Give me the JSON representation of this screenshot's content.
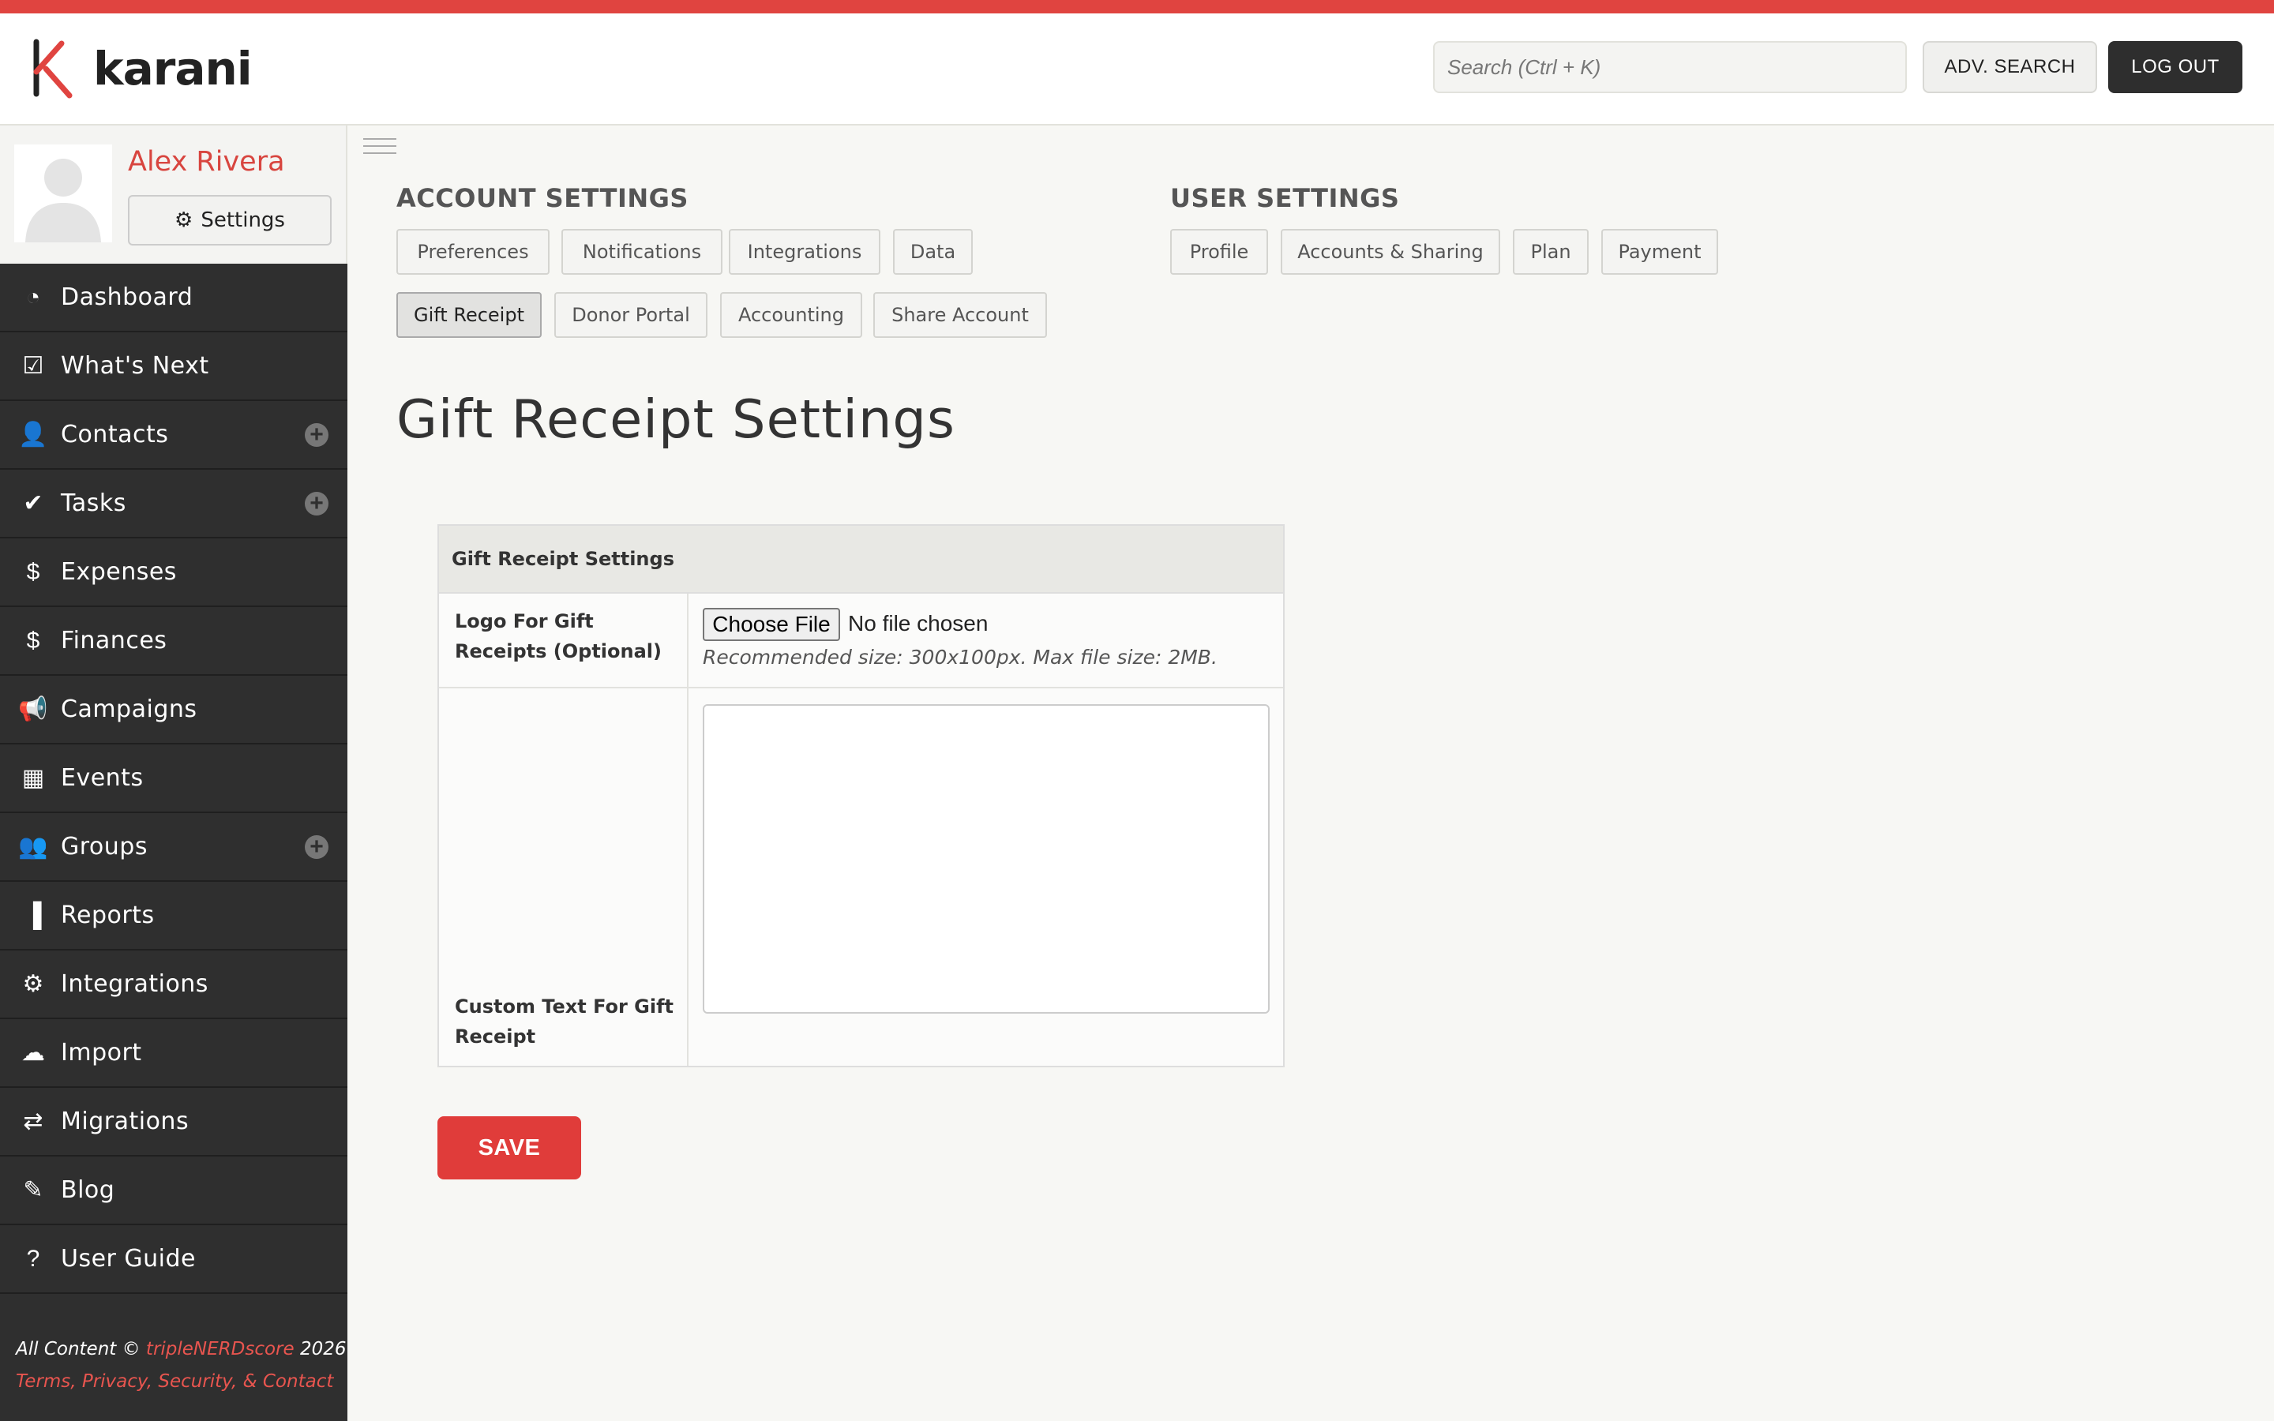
{
  "brand": {
    "name": "karani",
    "accent_color": "#e04440"
  },
  "header": {
    "search_placeholder": "Search (Ctrl + K)",
    "adv_search_label": "ADV. SEARCH",
    "logout_label": "LOG OUT"
  },
  "profile": {
    "name": "Alex Rivera",
    "settings_label": "Settings"
  },
  "sidebar": {
    "items": [
      {
        "label": "Dashboard",
        "icon": "dashboard-icon",
        "has_add": false
      },
      {
        "label": "What's Next",
        "icon": "check-square-icon",
        "has_add": false
      },
      {
        "label": "Contacts",
        "icon": "user-icon",
        "has_add": true
      },
      {
        "label": "Tasks",
        "icon": "check-icon",
        "has_add": true
      },
      {
        "label": "Expenses",
        "icon": "dollar-icon",
        "has_add": false
      },
      {
        "label": "Finances",
        "icon": "dollar-icon",
        "has_add": false
      },
      {
        "label": "Campaigns",
        "icon": "megaphone-icon",
        "has_add": false
      },
      {
        "label": "Events",
        "icon": "calendar-icon",
        "has_add": false
      },
      {
        "label": "Groups",
        "icon": "users-icon",
        "has_add": true
      },
      {
        "label": "Reports",
        "icon": "bar-chart-icon",
        "has_add": false
      },
      {
        "label": "Integrations",
        "icon": "gear-icon",
        "has_add": false
      },
      {
        "label": "Import",
        "icon": "cloud-upload-icon",
        "has_add": false
      },
      {
        "label": "Migrations",
        "icon": "swap-icon",
        "has_add": false
      },
      {
        "label": "Blog",
        "icon": "pencil-icon",
        "has_add": false
      },
      {
        "label": "User Guide",
        "icon": "question-icon",
        "has_add": false
      }
    ],
    "footer": {
      "line1_prefix": "All Content © ",
      "line1_link": "tripleNERDscore",
      "line1_suffix": " 2026",
      "line2_link": "Terms, Privacy, Security, & Contact"
    }
  },
  "account_settings": {
    "title": "ACCOUNT SETTINGS",
    "tabs": [
      "Preferences",
      "Notifications",
      "Integrations",
      "Data",
      "Gift Receipt",
      "Donor Portal",
      "Accounting",
      "Share Account"
    ],
    "active_tab": "Gift Receipt"
  },
  "user_settings": {
    "title": "USER SETTINGS",
    "tabs": [
      "Profile",
      "Accounts & Sharing",
      "Plan",
      "Payment"
    ]
  },
  "page": {
    "title": "Gift Receipt Settings",
    "card_title": "Gift Receipt Settings",
    "logo_label": "Logo For Gift Receipts (Optional)",
    "choose_file_label": "Choose File",
    "file_status": "No file chosen",
    "file_hint": "Recommended size: 300x100px. Max file size: 2MB.",
    "custom_text_label": "Custom Text For Gift Receipt",
    "custom_text_value": "",
    "save_label": "SAVE"
  }
}
